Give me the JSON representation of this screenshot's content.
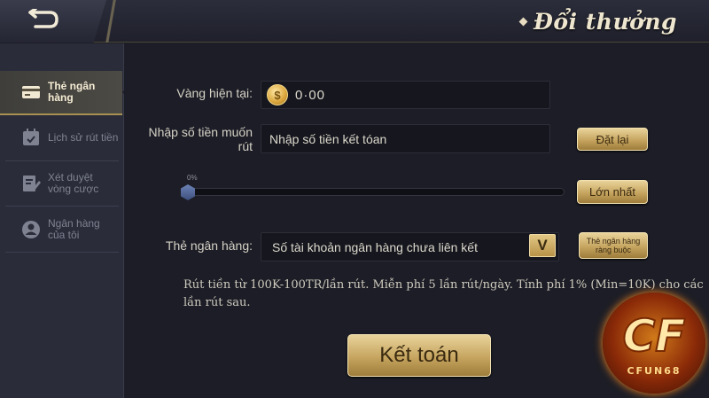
{
  "header": {
    "title": "Đổi thưởng",
    "back_icon": "return-arrow-icon"
  },
  "sidebar": {
    "items": [
      {
        "label": "Thẻ ngân hàng",
        "icon": "bank-card-icon",
        "active": true
      },
      {
        "label": "Lịch sử rút tiền",
        "icon": "calendar-check-icon",
        "active": false
      },
      {
        "label": "Xét duyệt vòng cược",
        "icon": "edit-document-icon",
        "active": false
      },
      {
        "label": "Ngân hàng của tôi",
        "icon": "user-icon",
        "active": false
      }
    ]
  },
  "form": {
    "balance_label": "Vàng hiện tại:",
    "balance_value": "0·00",
    "balance_icon": "gold-coin-icon",
    "amount_label": "Nhập số tiền muốn rút",
    "amount_placeholder": "Nhập số tiền kết tóan",
    "reset_button": "Đặt lại",
    "slider_value": "0%",
    "slider_fraction": 0,
    "max_button": "Lớn nhất",
    "bank_label": "Thẻ ngân hàng:",
    "bank_value": "Số tài khoản ngân hàng chưa liên kết",
    "dropdown_letter": "V",
    "link_bank_button": "Thẻ ngân hàng ràng buộc",
    "note": "Rút tiền từ 100K-100TR/lần rút. Miễn phí 5 lần rút/ngày. Tính phí 1% (Min=10K) cho các lần rút sau.",
    "submit_button": "Kết toán"
  },
  "logo": {
    "text": "CF",
    "subtext": "CFUN68"
  },
  "colors": {
    "background": "#1c1d26",
    "sidebar": "#2a2c3a",
    "gold": "#c6a560",
    "text": "#d6d2c6"
  }
}
